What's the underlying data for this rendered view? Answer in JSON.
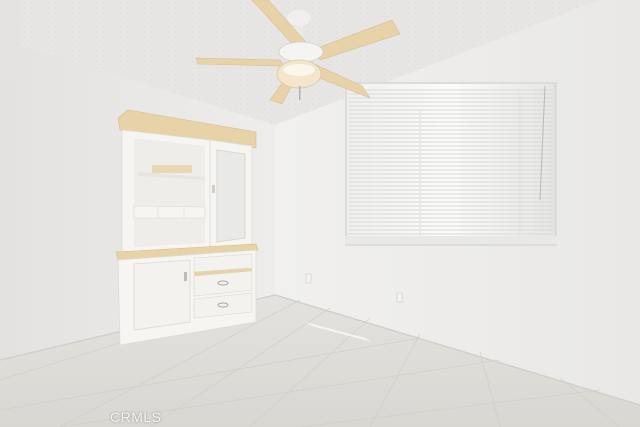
{
  "watermark": {
    "text": "CRMLS"
  },
  "colors": {
    "wall_left": "#e9e8e6",
    "wall_right": "#efeeec",
    "ceiling": "#e6e5e3",
    "floor": "#dedcd7",
    "cabinet_white": "#f6f5f1",
    "cabinet_wood": "#e8d2a8",
    "window_glow": "#f7f7f5"
  },
  "objects": [
    "ceiling-fan",
    "hutch-cabinet",
    "window-blinds",
    "tile-floor",
    "wall-outlet"
  ]
}
